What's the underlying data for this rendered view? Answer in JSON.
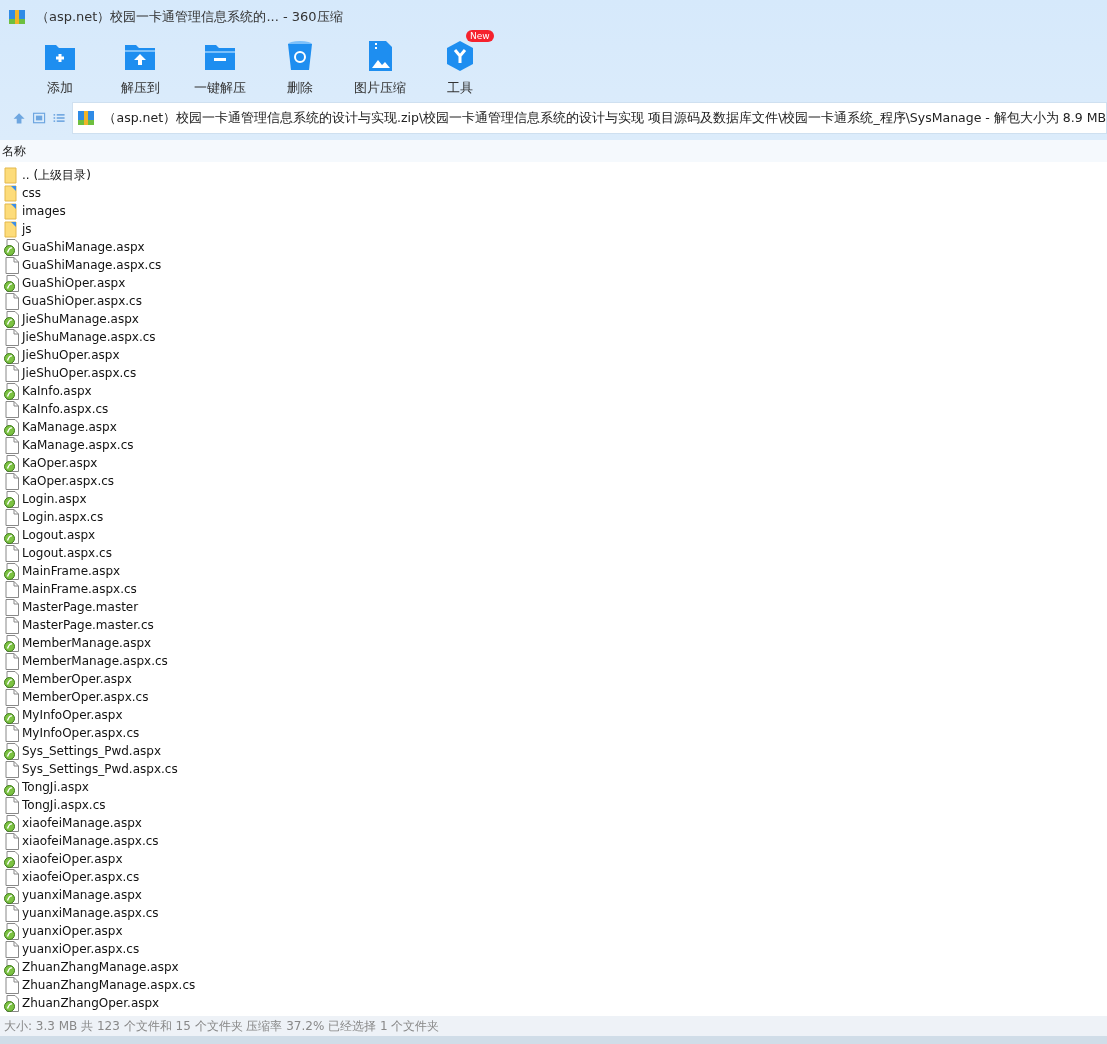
{
  "window": {
    "title": "（asp.net）校园一卡通管理信息系统的... - 360压缩"
  },
  "toolbar": [
    {
      "kind": "add",
      "label": "添加"
    },
    {
      "kind": "extract-to",
      "label": "解压到"
    },
    {
      "kind": "extract",
      "label": "一键解压"
    },
    {
      "kind": "delete",
      "label": "删除"
    },
    {
      "kind": "image",
      "label": "图片压缩"
    },
    {
      "kind": "tools",
      "label": "工具",
      "badge": "New"
    }
  ],
  "address": {
    "path": "（asp.net）校园一卡通管理信息系统的设计与实现.zip\\校园一卡通管理信息系统的设计与实现 项目源码及数据库文件\\校园一卡通系统_程序\\SysManage - 解包大小为 8.9 MB"
  },
  "table": {
    "columns": [
      "名称"
    ],
    "rows": [
      {
        "kind": "parent",
        "name": ".. (上级目录)"
      },
      {
        "kind": "folder",
        "name": "css"
      },
      {
        "kind": "folder",
        "name": "images"
      },
      {
        "kind": "folder",
        "name": "js"
      },
      {
        "kind": "aspx",
        "name": "GuaShiManage.aspx"
      },
      {
        "kind": "file",
        "name": "GuaShiManage.aspx.cs"
      },
      {
        "kind": "aspx",
        "name": "GuaShiOper.aspx"
      },
      {
        "kind": "file",
        "name": "GuaShiOper.aspx.cs"
      },
      {
        "kind": "aspx",
        "name": "JieShuManage.aspx"
      },
      {
        "kind": "file",
        "name": "JieShuManage.aspx.cs"
      },
      {
        "kind": "aspx",
        "name": "JieShuOper.aspx"
      },
      {
        "kind": "file",
        "name": "JieShuOper.aspx.cs"
      },
      {
        "kind": "aspx",
        "name": "KaInfo.aspx"
      },
      {
        "kind": "file",
        "name": "KaInfo.aspx.cs"
      },
      {
        "kind": "aspx",
        "name": "KaManage.aspx"
      },
      {
        "kind": "file",
        "name": "KaManage.aspx.cs"
      },
      {
        "kind": "aspx",
        "name": "KaOper.aspx"
      },
      {
        "kind": "file",
        "name": "KaOper.aspx.cs"
      },
      {
        "kind": "aspx",
        "name": "Login.aspx"
      },
      {
        "kind": "file",
        "name": "Login.aspx.cs"
      },
      {
        "kind": "aspx",
        "name": "Logout.aspx"
      },
      {
        "kind": "file",
        "name": "Logout.aspx.cs"
      },
      {
        "kind": "aspx",
        "name": "MainFrame.aspx"
      },
      {
        "kind": "file",
        "name": "MainFrame.aspx.cs"
      },
      {
        "kind": "file",
        "name": "MasterPage.master"
      },
      {
        "kind": "file",
        "name": "MasterPage.master.cs"
      },
      {
        "kind": "aspx",
        "name": "MemberManage.aspx"
      },
      {
        "kind": "file",
        "name": "MemberManage.aspx.cs"
      },
      {
        "kind": "aspx",
        "name": "MemberOper.aspx"
      },
      {
        "kind": "file",
        "name": "MemberOper.aspx.cs"
      },
      {
        "kind": "aspx",
        "name": "MyInfoOper.aspx"
      },
      {
        "kind": "file",
        "name": "MyInfoOper.aspx.cs"
      },
      {
        "kind": "aspx",
        "name": "Sys_Settings_Pwd.aspx"
      },
      {
        "kind": "file",
        "name": "Sys_Settings_Pwd.aspx.cs"
      },
      {
        "kind": "aspx",
        "name": "TongJi.aspx"
      },
      {
        "kind": "file",
        "name": "TongJi.aspx.cs"
      },
      {
        "kind": "aspx",
        "name": "xiaofeiManage.aspx"
      },
      {
        "kind": "file",
        "name": "xiaofeiManage.aspx.cs"
      },
      {
        "kind": "aspx",
        "name": "xiaofeiOper.aspx"
      },
      {
        "kind": "file",
        "name": "xiaofeiOper.aspx.cs"
      },
      {
        "kind": "aspx",
        "name": "yuanxiManage.aspx"
      },
      {
        "kind": "file",
        "name": "yuanxiManage.aspx.cs"
      },
      {
        "kind": "aspx",
        "name": "yuanxiOper.aspx"
      },
      {
        "kind": "file",
        "name": "yuanxiOper.aspx.cs"
      },
      {
        "kind": "aspx",
        "name": "ZhuanZhangManage.aspx"
      },
      {
        "kind": "file",
        "name": "ZhuanZhangManage.aspx.cs"
      },
      {
        "kind": "aspx",
        "name": "ZhuanZhangOper.aspx"
      }
    ]
  },
  "status_bar": {
    "text": "大小: 3.3 MB 共 123 个文件和 15 个文件夹 压缩率 37.2% 已经选择 1 个文件夹"
  }
}
